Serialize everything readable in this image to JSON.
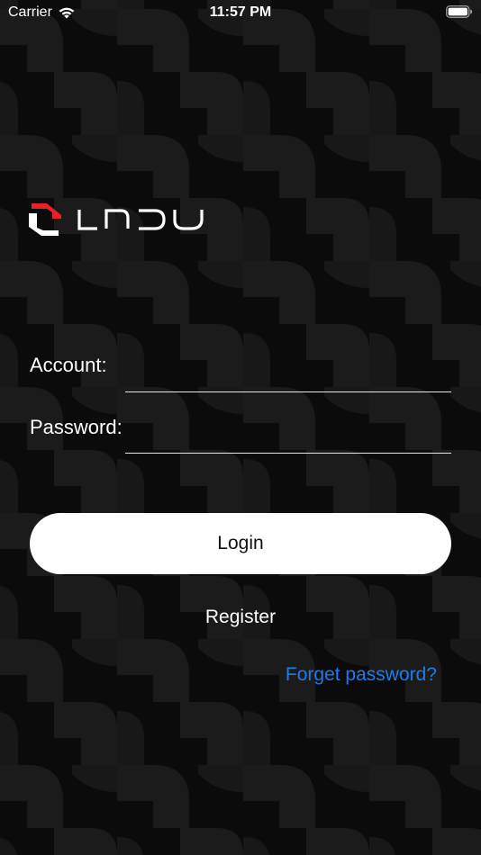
{
  "status_bar": {
    "carrier": "Carrier",
    "time": "11:57 PM",
    "wifi_icon": "wifi-icon",
    "battery_icon": "battery-icon"
  },
  "brand": {
    "name": "LNDU",
    "mark_color": "#e8202a"
  },
  "form": {
    "account_label": "Account:",
    "account_value": "",
    "password_label": "Password:",
    "password_value": ""
  },
  "actions": {
    "login_label": "Login",
    "register_label": "Register",
    "forget_label": "Forget password?"
  },
  "colors": {
    "background": "#0b0b0b",
    "pattern": "#1b1b1b",
    "link": "#1a7cf0",
    "button": "#ffffff"
  }
}
